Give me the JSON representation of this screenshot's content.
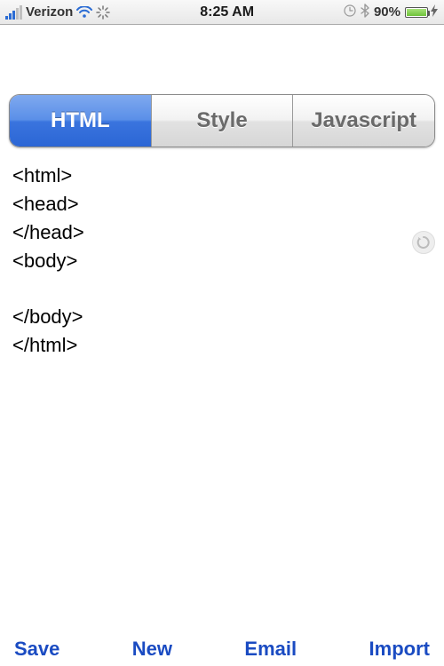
{
  "status_bar": {
    "carrier": "Verizon",
    "time": "8:25 AM",
    "battery_percent": "90%"
  },
  "tabs": {
    "html": "HTML",
    "style": "Style",
    "javascript": "Javascript"
  },
  "editor": {
    "content": "<html>\n<head>\n</head>\n<body>\n\n</body>\n</html>"
  },
  "toolbar": {
    "save": "Save",
    "new": "New",
    "email": "Email",
    "import": "Import"
  }
}
